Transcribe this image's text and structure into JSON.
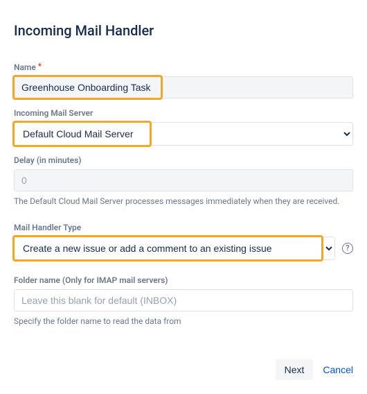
{
  "title": "Incoming Mail Handler",
  "fields": {
    "name": {
      "label": "Name",
      "required": true,
      "value": "Greenhouse Onboarding Task",
      "highlight_width": 217
    },
    "server": {
      "label": "Incoming Mail Server",
      "value": "Default Cloud Mail Server",
      "highlight_width": 201
    },
    "delay": {
      "label": "Delay (in minutes)",
      "value": "",
      "placeholder": "0",
      "helper": "The Default Cloud Mail Server processes messages immediately when they are received."
    },
    "handler_type": {
      "label": "Mail Handler Type",
      "value": "Create a new issue or add a comment to an existing issue",
      "highlight_width": 449
    },
    "folder": {
      "label": "Folder name (Only for IMAP mail servers)",
      "value": "",
      "placeholder": "Leave this blank for default (INBOX)",
      "helper": "Specify the folder name to read the data from"
    }
  },
  "footer": {
    "next": "Next",
    "cancel": "Cancel"
  },
  "icons": {
    "help": "?"
  }
}
